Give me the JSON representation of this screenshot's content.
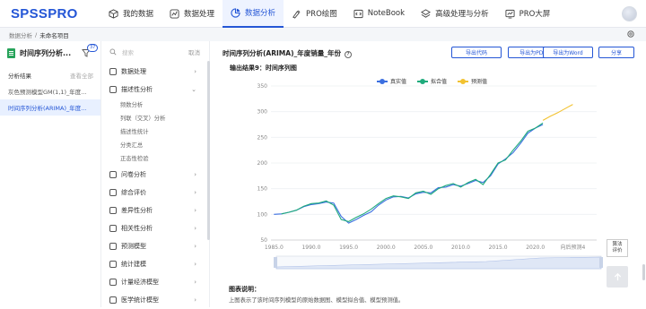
{
  "app": {
    "logo": "SPSSPRO"
  },
  "nav": [
    {
      "label": "我的数据",
      "icon": "cube-icon"
    },
    {
      "label": "数据处理",
      "icon": "data-process-icon"
    },
    {
      "label": "数据分析",
      "icon": "pie-chart-icon",
      "active": true
    },
    {
      "label": "PRO绘图",
      "icon": "paint-icon"
    },
    {
      "label": "NoteBook",
      "icon": "code-icon"
    },
    {
      "label": "高级处理与分析",
      "icon": "layers-icon"
    },
    {
      "label": "PRO大屏",
      "icon": "dashboard-icon"
    }
  ],
  "breadcrumb": {
    "root": "数据分析",
    "sep": "/",
    "current": "未命名项目"
  },
  "project": {
    "title": "时间序列分析...",
    "badge": "37",
    "results_label": "分析结果",
    "view_all": "查看全部",
    "items": [
      {
        "label": "灰色预测模型GM(1,1)_年度...",
        "active": false
      },
      {
        "label": "时间序列分析(ARIMA)_年度...",
        "active": true
      }
    ]
  },
  "menu": {
    "search_placeholder": "搜索",
    "cancel": "取消",
    "groups": [
      {
        "label": "数据处理",
        "chev": "›"
      },
      {
        "label": "描述性分析",
        "chev": "⌄",
        "subs": [
          "频数分析",
          "列联（交叉）分析",
          "描述性统计",
          "分类汇总",
          "正态性检验"
        ]
      },
      {
        "label": "问卷分析",
        "chev": "›"
      },
      {
        "label": "综合评价",
        "chev": "›"
      },
      {
        "label": "差异性分析",
        "chev": "›"
      },
      {
        "label": "相关性分析",
        "chev": "›"
      },
      {
        "label": "预测模型",
        "chev": "›"
      },
      {
        "label": "统计建模",
        "chev": "›"
      },
      {
        "label": "计量经济模型",
        "chev": "›"
      },
      {
        "label": "医学统计模型",
        "chev": "›"
      }
    ]
  },
  "main": {
    "title": "时间序列分析(ARIMA)_年度销量_年份",
    "help": "?",
    "buttons": [
      "导出代码",
      "导出为PDF",
      "导出为Word",
      "分享"
    ],
    "subtitle": "输出结果9：时间序列图",
    "side_button": [
      "算法",
      "评价"
    ],
    "desc_title": "图表说明：",
    "desc_text": "上图表示了该时间序列模型的原始数据图、模型拟合值、模型预测值。"
  },
  "chart_data": {
    "type": "line",
    "ylim": [
      50,
      350
    ],
    "yticks": [
      "50",
      "100",
      "150",
      "200",
      "250",
      "300",
      "350"
    ],
    "xticks": [
      "1985.0",
      "1990.0",
      "1995.0",
      "2000.0",
      "2005.0",
      "2010.0",
      "2015.0",
      "2020.0",
      "向后预测4"
    ],
    "series": [
      {
        "name": "真实值",
        "color": "#3b6fe0",
        "x": [
          1985,
          1986,
          1987,
          1988,
          1989,
          1990,
          1991,
          1992,
          1993,
          1994,
          1995,
          1996,
          1997,
          1998,
          1999,
          2000,
          2001,
          2002,
          2003,
          2004,
          2005,
          2006,
          2007,
          2008,
          2009,
          2010,
          2011,
          2012,
          2013,
          2014,
          2015,
          2016,
          2017,
          2018,
          2019,
          2020,
          2021
        ],
        "y": [
          100,
          101,
          104,
          108,
          115,
          119,
          121,
          124,
          122,
          96,
          83,
          90,
          98,
          105,
          118,
          128,
          134,
          135,
          132,
          140,
          143,
          142,
          152,
          153,
          158,
          155,
          160,
          166,
          162,
          175,
          198,
          208,
          220,
          238,
          258,
          268,
          275
        ]
      },
      {
        "name": "拟合值",
        "color": "#1fab7c",
        "x": [
          1986,
          1987,
          1988,
          1989,
          1990,
          1991,
          1992,
          1993,
          1994,
          1995,
          1996,
          1997,
          1998,
          1999,
          2000,
          2001,
          2002,
          2003,
          2004,
          2005,
          2006,
          2007,
          2008,
          2009,
          2010,
          2011,
          2012,
          2013,
          2014,
          2015,
          2016,
          2017,
          2018,
          2019,
          2020,
          2021
        ],
        "y": [
          101,
          104,
          108,
          116,
          121,
          122,
          126,
          118,
          90,
          86,
          94,
          101,
          110,
          121,
          131,
          136,
          134,
          131,
          142,
          145,
          139,
          150,
          156,
          160,
          153,
          162,
          168,
          158,
          178,
          200,
          206,
          225,
          242,
          262,
          268,
          278
        ]
      },
      {
        "name": "预测值",
        "color": "#f2c230",
        "x": [
          2021,
          2022,
          2023,
          2024,
          2025
        ],
        "y": [
          283,
          291,
          298,
          306,
          314
        ]
      }
    ]
  }
}
